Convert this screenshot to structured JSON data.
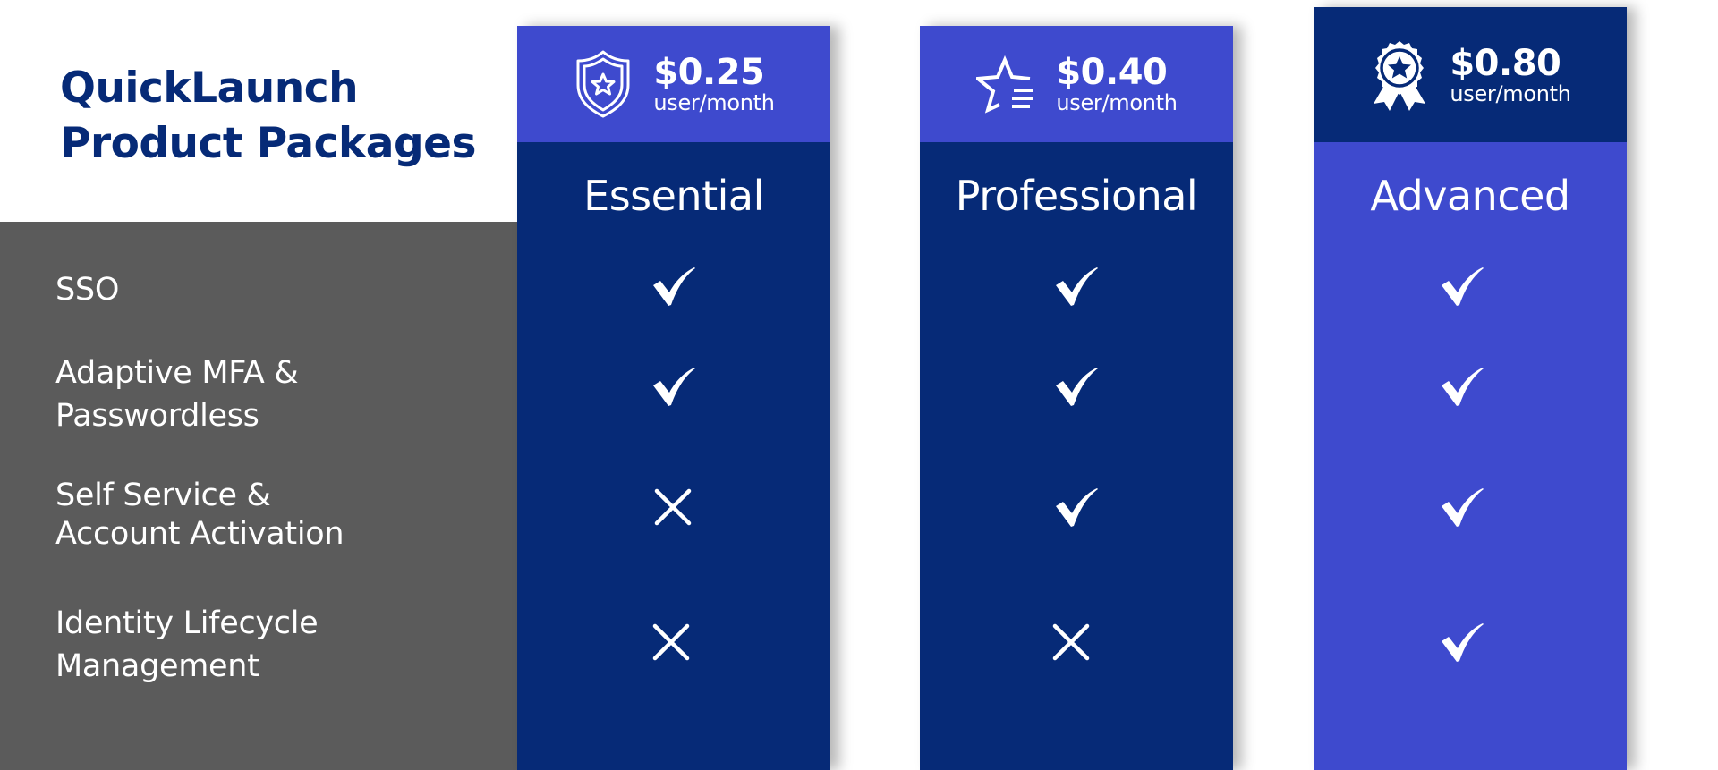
{
  "title": {
    "line1": "QuickLaunch",
    "line2": "Product Packages"
  },
  "features": [
    {
      "lines": [
        "SSO"
      ]
    },
    {
      "lines": [
        "Adaptive MFA &",
        "Passwordless"
      ]
    },
    {
      "lines": [
        "Self Service &",
        "Account Activation"
      ]
    },
    {
      "lines": [
        "Identity Lifecycle",
        "Management"
      ]
    }
  ],
  "packages": [
    {
      "name": "Essential",
      "price": "$0.25",
      "unit": "user/month",
      "icon": "shield-star-icon",
      "header_color": "#3E4ACE",
      "body_color": "#062A77",
      "features": [
        "included",
        "included",
        "not-included",
        "not-included"
      ]
    },
    {
      "name": "Professional",
      "price": "$0.40",
      "unit": "user/month",
      "icon": "star-list-icon",
      "header_color": "#3E4ACE",
      "body_color": "#062A77",
      "features": [
        "included",
        "included",
        "included",
        "not-included"
      ]
    },
    {
      "name": "Advanced",
      "price": "$0.80",
      "unit": "user/month",
      "icon": "award-ribbon-icon",
      "header_color": "#062A77",
      "body_color": "#3E4ACE",
      "features": [
        "included",
        "included",
        "included",
        "included"
      ]
    }
  ],
  "colors": {
    "title": "#062A77",
    "feature_panel": "#5B5B5B",
    "navy": "#062A77",
    "blue": "#3E4ACE"
  }
}
